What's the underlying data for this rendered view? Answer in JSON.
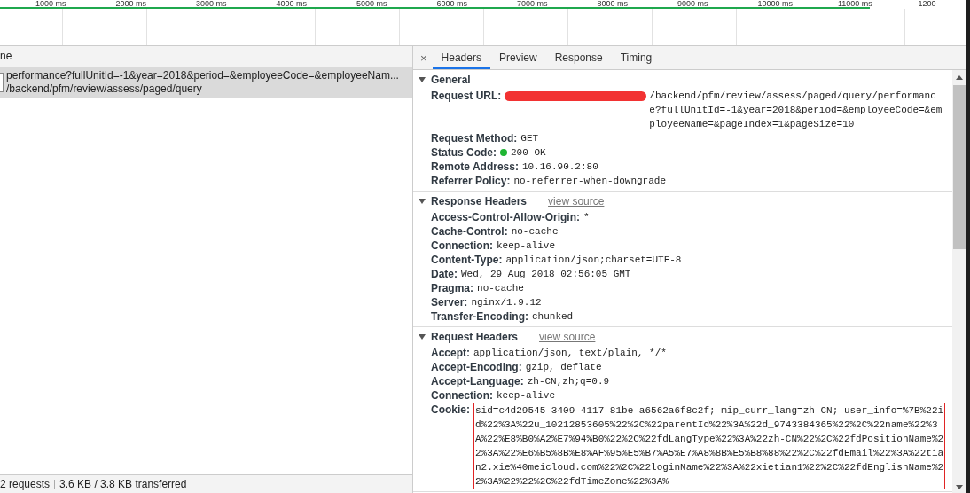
{
  "timeline": {
    "ticks": [
      "1000 ms",
      "2000 ms",
      "3000 ms",
      "4000 ms",
      "5000 ms",
      "6000 ms",
      "7000 ms",
      "8000 ms",
      "9000 ms",
      "10000 ms",
      "11000 ms",
      "1200"
    ],
    "level": 0.9
  },
  "request_list": {
    "column": "ne",
    "rows": [
      {
        "name": "performance?fullUnitId=-1&year=2018&period=&employeeCode=&employeeNam...",
        "path": "/backend/pfm/review/assess/paged/query",
        "selected": true
      }
    ]
  },
  "status_bar": {
    "requests": "2 requests",
    "transferred": "3.6 KB / 3.8 KB transferred"
  },
  "details": {
    "close": "×",
    "tabs": [
      {
        "label": "Headers",
        "selected": true
      },
      {
        "label": "Preview",
        "selected": false
      },
      {
        "label": "Response",
        "selected": false
      },
      {
        "label": "Timing",
        "selected": false
      }
    ],
    "sections": [
      {
        "title": "General",
        "expanded": true,
        "rows": [
          {
            "key": "Request URL:",
            "value": "/backend/pfm/review/assess/paged/query/performance?fullUnitId=-1&year=2018&period=&employeeCode=&employeeName=&pageIndex=1&pageSize=10",
            "kind": "redacted"
          },
          {
            "key": "Request Method:",
            "value": "GET",
            "kind": "plain"
          },
          {
            "key": "Status Code:",
            "value": "200 OK",
            "kind": "status"
          },
          {
            "key": "Remote Address:",
            "value": "10.16.90.2:80",
            "kind": "plain"
          },
          {
            "key": "Referrer Policy:",
            "value": "no-referrer-when-downgrade",
            "kind": "plain"
          }
        ]
      },
      {
        "title": "Response Headers",
        "link": "view source",
        "expanded": true,
        "rows": [
          {
            "key": "Access-Control-Allow-Origin:",
            "value": "*",
            "kind": "plain"
          },
          {
            "key": "Cache-Control:",
            "value": "no-cache",
            "kind": "plain"
          },
          {
            "key": "Connection:",
            "value": "keep-alive",
            "kind": "plain"
          },
          {
            "key": "Content-Type:",
            "value": "application/json;charset=UTF-8",
            "kind": "plain"
          },
          {
            "key": "Date:",
            "value": "Wed, 29 Aug 2018 02:56:05 GMT",
            "kind": "plain"
          },
          {
            "key": "Pragma:",
            "value": "no-cache",
            "kind": "plain"
          },
          {
            "key": "Server:",
            "value": "nginx/1.9.12",
            "kind": "plain"
          },
          {
            "key": "Transfer-Encoding:",
            "value": "chunked",
            "kind": "plain"
          }
        ]
      },
      {
        "title": "Request Headers",
        "link": "view source",
        "expanded": true,
        "rows": [
          {
            "key": "Accept:",
            "value": "application/json, text/plain, */*",
            "kind": "plain"
          },
          {
            "key": "Accept-Encoding:",
            "value": "gzip, deflate",
            "kind": "plain"
          },
          {
            "key": "Accept-Language:",
            "value": "zh-CN,zh;q=0.9",
            "kind": "plain"
          },
          {
            "key": "Connection:",
            "value": "keep-alive",
            "kind": "plain"
          },
          {
            "key": "Cookie:",
            "value": "sid=c4d29545-3409-4117-81be-a6562a6f8c2f; mip_curr_lang=zh-CN; user_info=%7B%22id%22%3A%22u_10212853605%22%2C%22parentId%22%3A%22d_9743384365%22%2C%22name%22%3A%22%E8%B0%A2%E7%94%B0%22%2C%22fdLangType%22%3A%22zh-CN%22%2C%22fdPositionName%22%3A%22%E6%B5%8B%E8%AF%95%E5%B7%A5%E7%A8%8B%E5%B8%88%22%2C%22fdEmail%22%3A%22tian2.xie%40meicloud.com%22%2C%22loginName%22%3A%22xietian1%22%2C%22fdEnglishName%22%3A%22%22%2C%22fdTimeZone%22%3A%",
            "kind": "highlighted"
          }
        ]
      }
    ]
  }
}
